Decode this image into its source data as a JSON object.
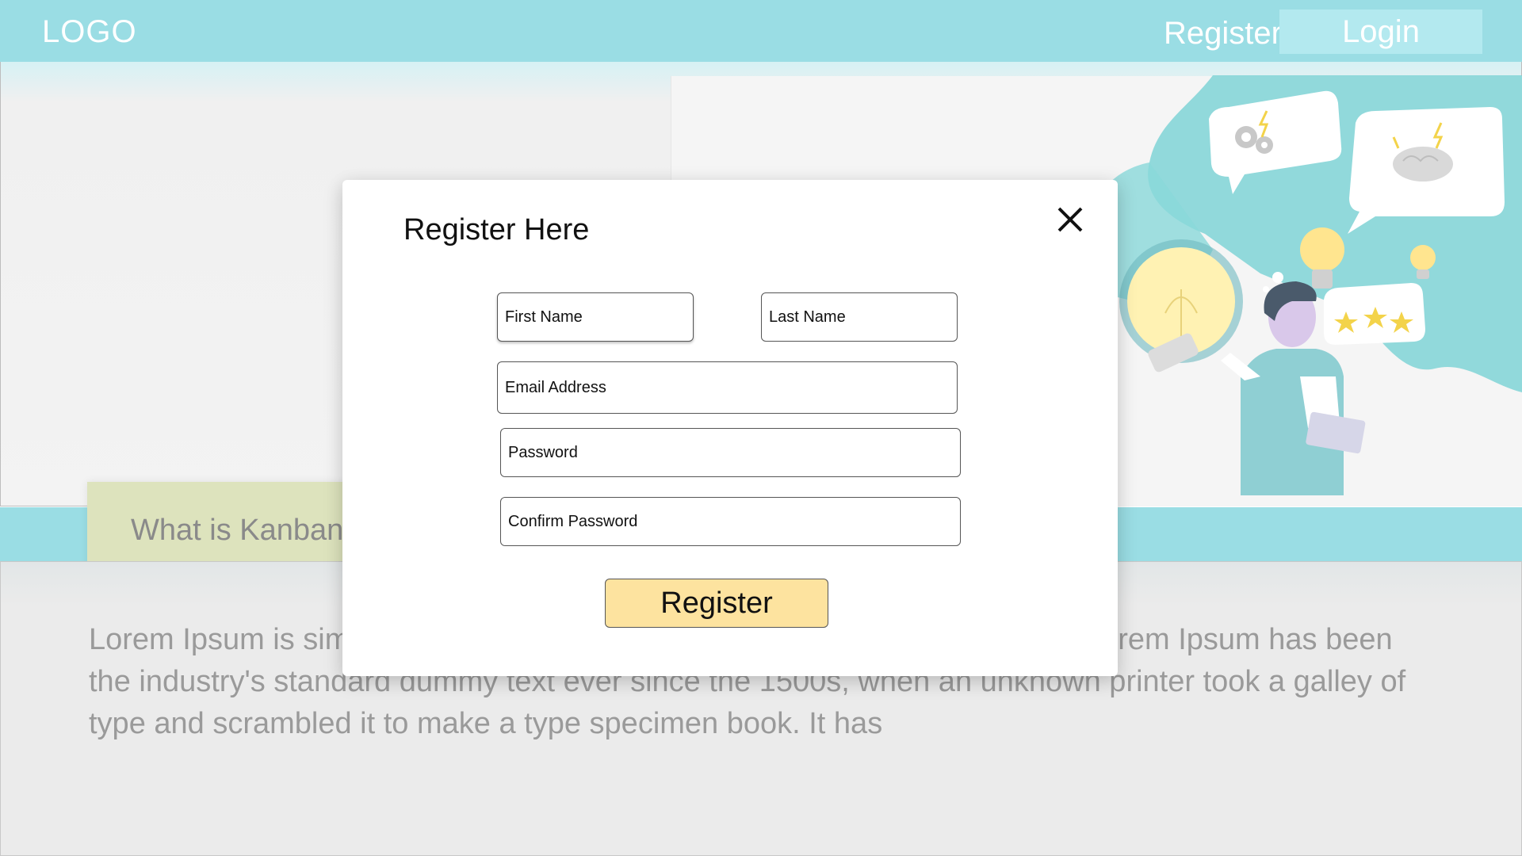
{
  "header": {
    "logo": "LOGO",
    "register_label": "Register",
    "login_label": "Login"
  },
  "hero": {
    "illustration": "idea-person-illustration"
  },
  "section": {
    "heading": "What is Kanban",
    "body": "Lorem Ipsum is simply dummy text of the printing and typesetting industry. Lorem Ipsum has been the industry's standard dummy text ever since the 1500s, when an unknown printer took a galley of type and scrambled it to make a type specimen book. It has"
  },
  "modal": {
    "title": "Register Here",
    "close_icon": "close-icon",
    "fields": {
      "first_name": {
        "placeholder": "First Name",
        "value": ""
      },
      "last_name": {
        "placeholder": "Last Name",
        "value": ""
      },
      "email": {
        "placeholder": "Email Address",
        "value": ""
      },
      "password": {
        "placeholder": "Password",
        "value": ""
      },
      "confirm_password": {
        "placeholder": "Confirm Password",
        "value": ""
      }
    },
    "submit_label": "Register"
  },
  "colors": {
    "topbar": "#9adde4",
    "login_button": "#b3e9ef",
    "heading_card": "#dde3bd",
    "register_button": "#fde39f"
  }
}
